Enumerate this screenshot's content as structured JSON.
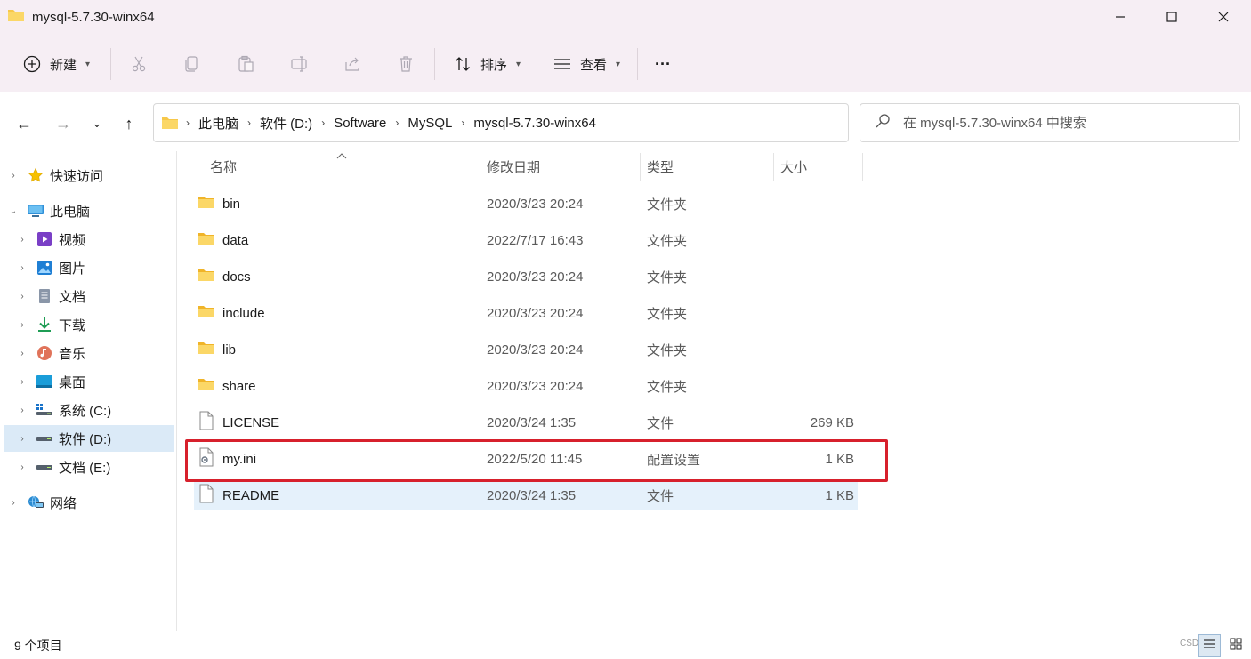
{
  "window": {
    "title": "mysql-5.7.30-winx64",
    "minimize": "—",
    "maximize": "☐",
    "close": "✕"
  },
  "toolbar": {
    "new_label": "新建",
    "sort_label": "排序",
    "view_label": "查看",
    "more_label": "···",
    "caret": "⌄"
  },
  "nav": {
    "back": "←",
    "forward": "→",
    "recent": "⌄",
    "up": "↑"
  },
  "address": {
    "crumbs": [
      "此电脑",
      "软件 (D:)",
      "Software",
      "MySQL",
      "mysql-5.7.30-winx64"
    ],
    "sep": "›"
  },
  "search": {
    "placeholder": "在 mysql-5.7.30-winx64 中搜索"
  },
  "sidebar": {
    "items": [
      {
        "label": "快速访问",
        "icon": "star-icon"
      },
      {
        "label": "此电脑",
        "icon": "computer-icon"
      },
      {
        "label": "视频",
        "icon": "video-icon"
      },
      {
        "label": "图片",
        "icon": "pictures-icon"
      },
      {
        "label": "文档",
        "icon": "documents-icon"
      },
      {
        "label": "下载",
        "icon": "download-icon"
      },
      {
        "label": "音乐",
        "icon": "music-icon"
      },
      {
        "label": "桌面",
        "icon": "desktop-icon"
      },
      {
        "label": "系统 (C:)",
        "icon": "drive-icon"
      },
      {
        "label": "软件 (D:)",
        "icon": "drive-icon",
        "selected": true
      },
      {
        "label": "文档 (E:)",
        "icon": "drive-icon"
      },
      {
        "label": "网络",
        "icon": "network-icon"
      }
    ]
  },
  "columns": {
    "name": "名称",
    "date": "修改日期",
    "type": "类型",
    "size": "大小"
  },
  "files": [
    {
      "name": "bin",
      "date": "2020/3/23 20:24",
      "type": "文件夹",
      "size": "",
      "kind": "folder"
    },
    {
      "name": "data",
      "date": "2022/7/17 16:43",
      "type": "文件夹",
      "size": "",
      "kind": "folder"
    },
    {
      "name": "docs",
      "date": "2020/3/23 20:24",
      "type": "文件夹",
      "size": "",
      "kind": "folder"
    },
    {
      "name": "include",
      "date": "2020/3/23 20:24",
      "type": "文件夹",
      "size": "",
      "kind": "folder"
    },
    {
      "name": "lib",
      "date": "2020/3/23 20:24",
      "type": "文件夹",
      "size": "",
      "kind": "folder"
    },
    {
      "name": "share",
      "date": "2020/3/23 20:24",
      "type": "文件夹",
      "size": "",
      "kind": "folder"
    },
    {
      "name": "LICENSE",
      "date": "2020/3/24 1:35",
      "type": "文件",
      "size": "269 KB",
      "kind": "file"
    },
    {
      "name": "my.ini",
      "date": "2022/5/20 11:45",
      "type": "配置设置",
      "size": "1 KB",
      "kind": "config"
    },
    {
      "name": "README",
      "date": "2020/3/24 1:35",
      "type": "文件",
      "size": "1 KB",
      "kind": "file"
    }
  ],
  "status": {
    "count": "9 个项目",
    "watermark": "CSDN@..."
  },
  "colors": {
    "titlebar": "#f6eef4",
    "selection": "#dbeaf7",
    "highlight_box": "#d7202c",
    "folder": "#f7c84a"
  }
}
